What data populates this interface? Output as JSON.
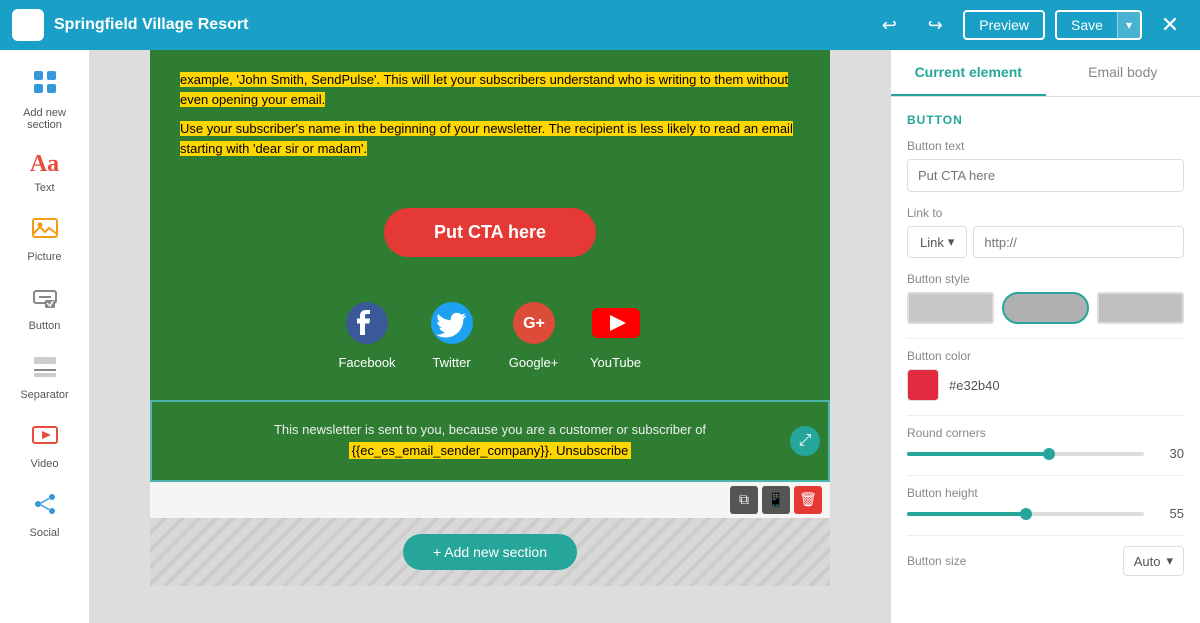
{
  "app": {
    "title": "Springfield Village Resort",
    "logo_char": "♥"
  },
  "toolbar": {
    "preview_label": "Preview",
    "save_label": "Save"
  },
  "left_sidebar": {
    "items": [
      {
        "id": "add-new-section",
        "label": "Add new\nsection",
        "icon": "⊞"
      },
      {
        "id": "text",
        "label": "Text",
        "icon": "Aa"
      },
      {
        "id": "picture",
        "label": "Picture",
        "icon": "🖼"
      },
      {
        "id": "button",
        "label": "Button",
        "icon": "⬚"
      },
      {
        "id": "separator",
        "label": "Separator",
        "icon": "⊟"
      },
      {
        "id": "video",
        "label": "Video",
        "icon": "▶"
      },
      {
        "id": "social",
        "label": "Social",
        "icon": "⋮"
      }
    ]
  },
  "canvas": {
    "text_blocks": [
      "example, 'John Smith, SendPulse'. This will let your subscribers understand who is writing to them without even opening your email.",
      "Use your subscriber's name in the beginning of your newsletter. The recipient is less likely to read an email starting with 'dear sir or madam'."
    ],
    "cta_button": "Put CTA here",
    "social_icons": [
      {
        "name": "Facebook",
        "color": "#3b5998"
      },
      {
        "name": "Twitter",
        "color": "#1da1f2"
      },
      {
        "name": "Google+",
        "color": "#dd4b39"
      },
      {
        "name": "YouTube",
        "color": "#ff0000"
      }
    ],
    "footer_line1": "This newsletter is sent to you, because you are a customer or subscriber of",
    "footer_line2": "{{ec_es_email_sender_company}}. Unsubscribe",
    "add_section_btn": "+ Add new section"
  },
  "right_panel": {
    "tab_current": "Current element",
    "tab_email_body": "Email body",
    "section_title": "BUTTON",
    "button_text_label": "Button text",
    "button_text_placeholder": "Put CTA here",
    "link_to_label": "Link to",
    "link_type": "Link",
    "link_url_placeholder": "http://",
    "button_style_label": "Button style",
    "button_color_label": "Button color",
    "button_color_hex": "#e32b40",
    "round_corners_label": "Round corners",
    "round_corners_value": "30",
    "round_corners_pct": 60,
    "button_height_label": "Button height",
    "button_height_value": "55",
    "button_height_pct": 50,
    "button_size_label": "Button size",
    "button_size_value": "Auto"
  }
}
